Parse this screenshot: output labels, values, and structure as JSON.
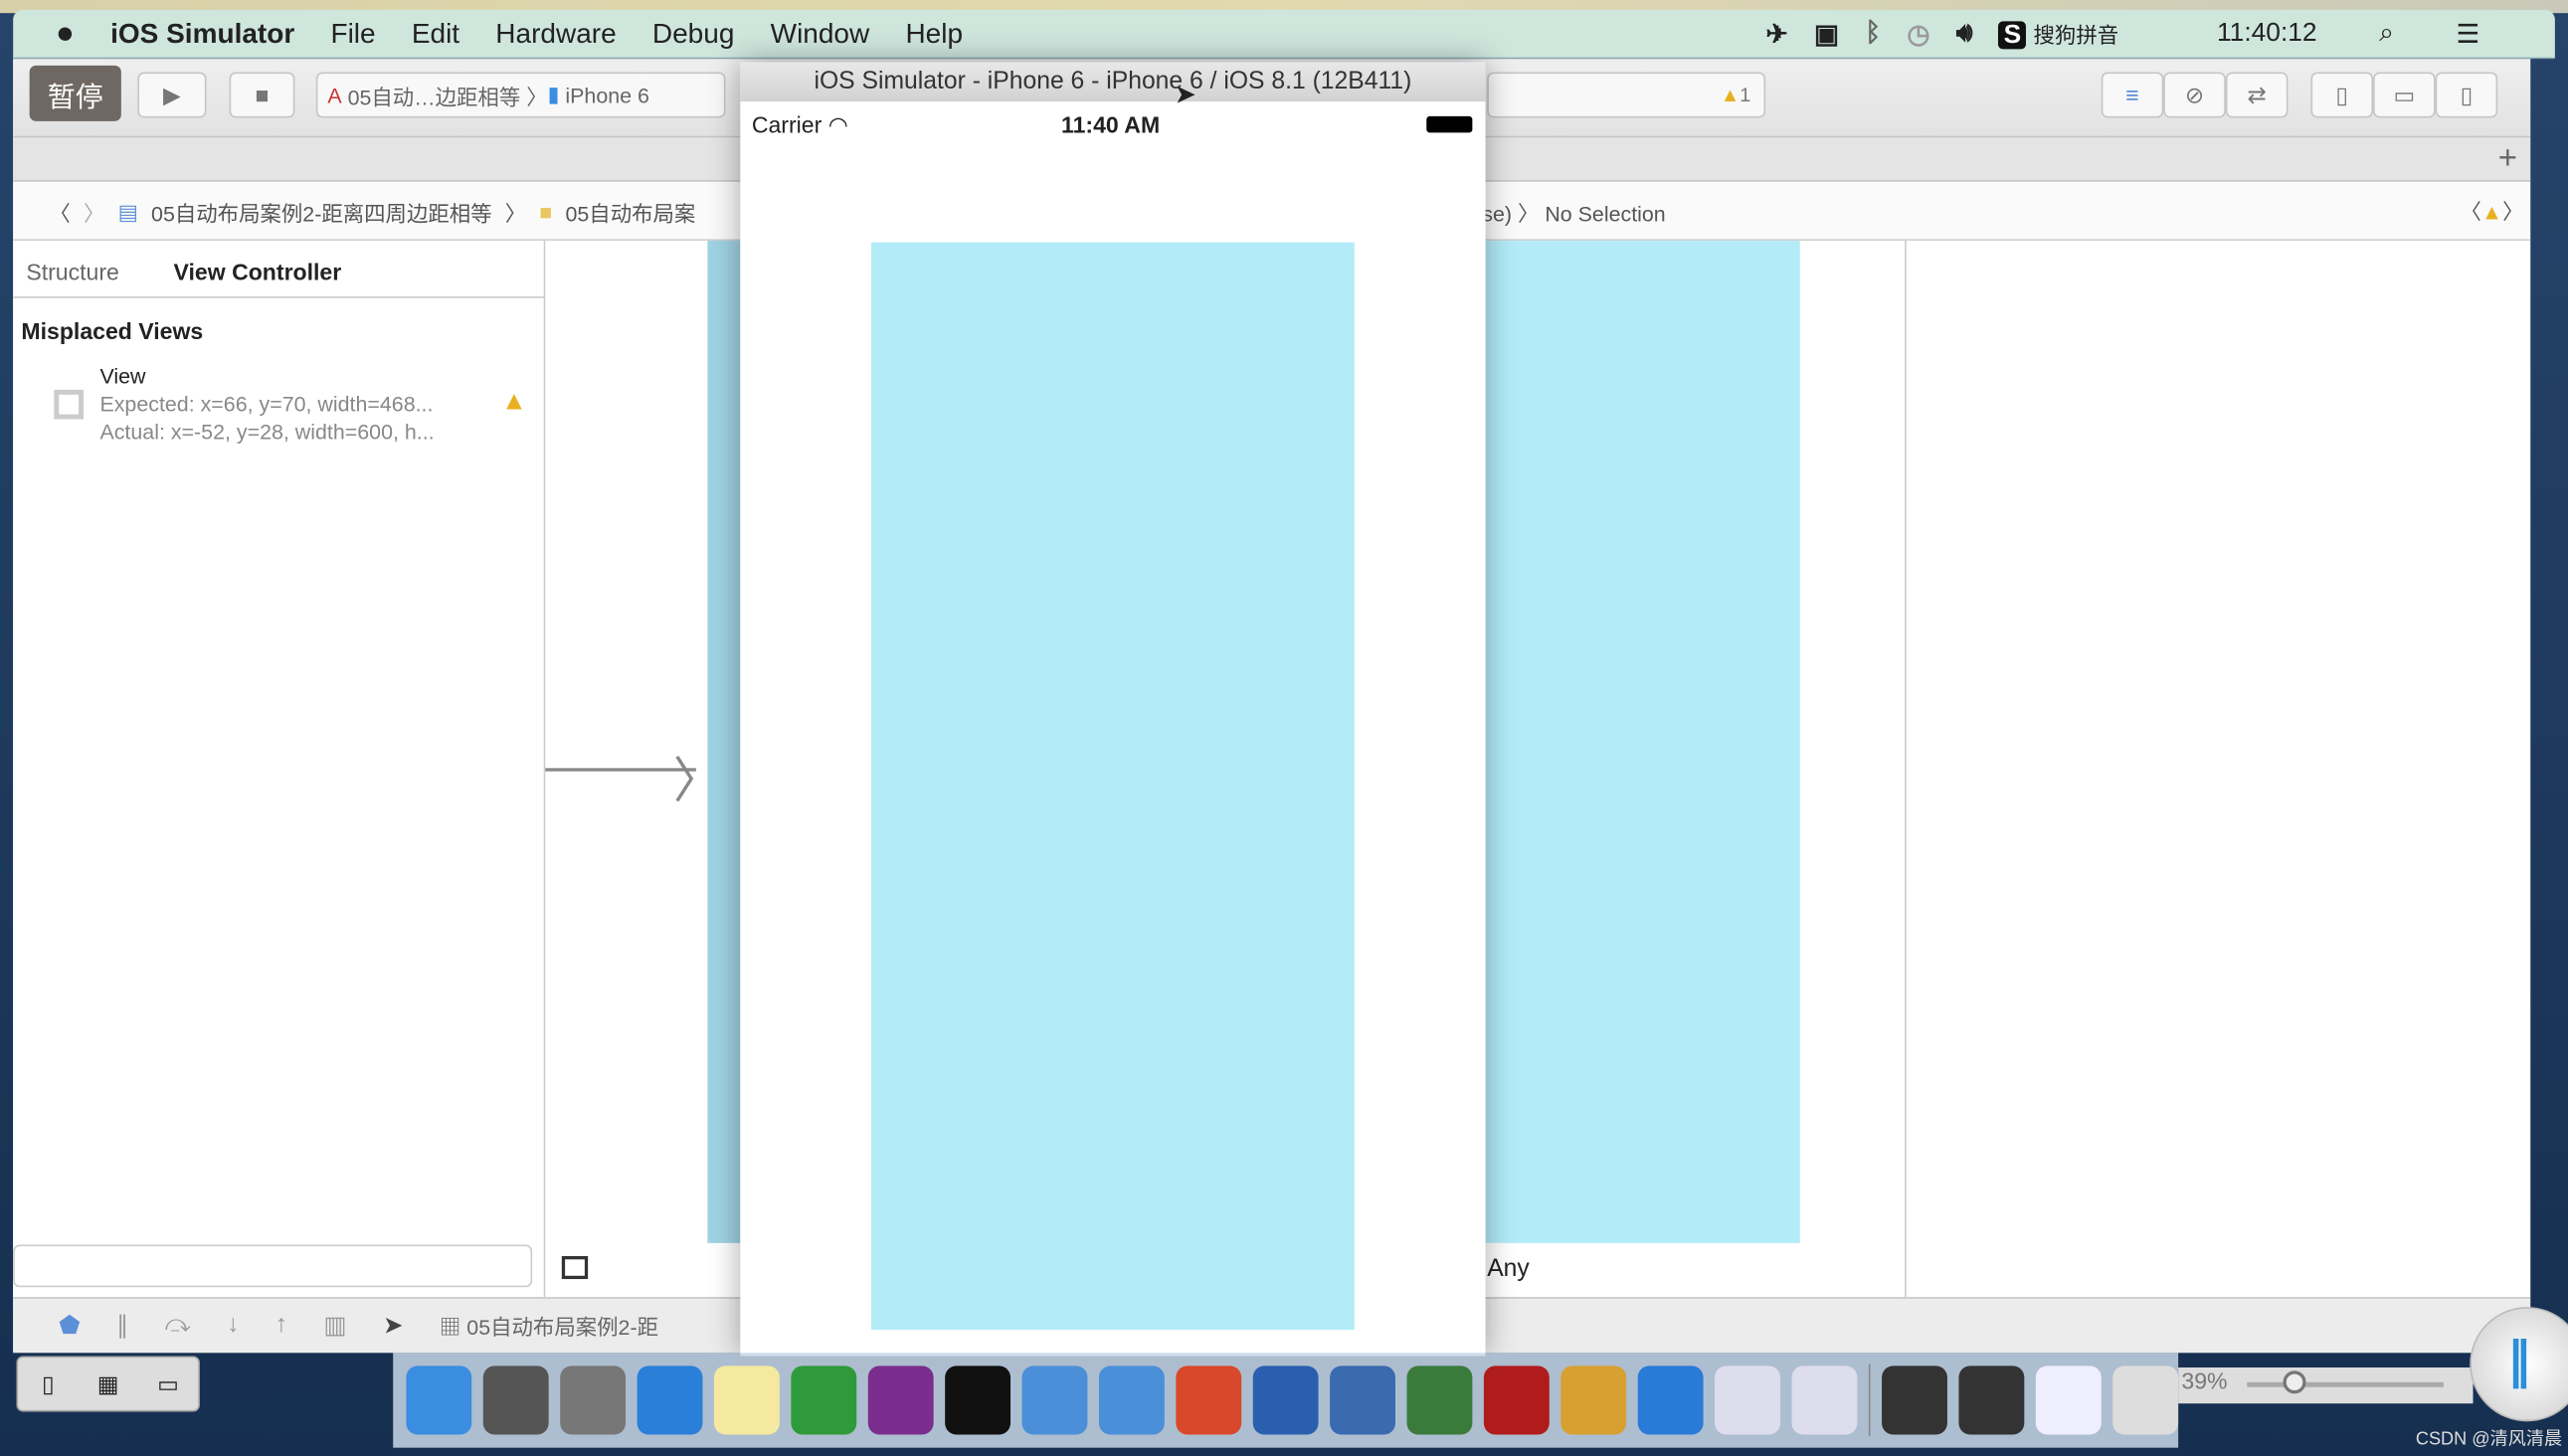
{
  "menubar": {
    "app": "iOS Simulator",
    "items": [
      "File",
      "Edit",
      "Hardware",
      "Debug",
      "Window",
      "Help"
    ],
    "input_method": "搜狗拼音",
    "clock": "11:40:12"
  },
  "toolbar": {
    "pause_label": "暂停",
    "scheme": "05自动…边距相等",
    "device": "iPhone 6",
    "warnings": "1"
  },
  "jumpbar": {
    "crumb1": "05自动布局案例2-距离四周边距相等",
    "crumb2": "05自动布局案",
    "crumb3": "se)",
    "crumb4": "No Selection"
  },
  "leftpanel": {
    "tabs": [
      "Structure",
      "View Controller"
    ],
    "section": "Misplaced Views",
    "item": {
      "name": "View",
      "expected": "Expected: x=66, y=70, width=468...",
      "actual": "Actual: x=-52, y=28, width=600, h..."
    }
  },
  "canvas": {
    "size_class": "Any"
  },
  "debugbar": {
    "target": "05自动布局案例2-距"
  },
  "simulator": {
    "title": "iOS Simulator - iPhone 6 - iPhone 6 / iOS 8.1 (12B411)",
    "carrier": "Carrier",
    "time": "11:40 AM",
    "view_color": "#b3ecf8"
  },
  "desktop": {
    "zoom_percent": "39%",
    "watermark": "CSDN @清风清晨"
  },
  "dock": [
    {
      "name": "finder",
      "color": "#3a8de0"
    },
    {
      "name": "system-preferences",
      "color": "#555"
    },
    {
      "name": "launchpad",
      "color": "#777"
    },
    {
      "name": "safari",
      "color": "#2a7fd8"
    },
    {
      "name": "notes",
      "color": "#f5e9a0"
    },
    {
      "name": "excel",
      "color": "#2f9a3a"
    },
    {
      "name": "onenote",
      "color": "#7a2d8c"
    },
    {
      "name": "terminal",
      "color": "#111"
    },
    {
      "name": "xcode",
      "color": "#4a8fd8"
    },
    {
      "name": "simulator",
      "color": "#4a8fd8"
    },
    {
      "name": "powerpoint",
      "color": "#d8482a"
    },
    {
      "name": "scissors",
      "color": "#2a5fb0"
    },
    {
      "name": "video",
      "color": "#3a6ab0"
    },
    {
      "name": "ftp",
      "color": "#3a7a3a"
    },
    {
      "name": "filezilla",
      "color": "#b01c1c"
    },
    {
      "name": "paint",
      "color": "#d8a030"
    },
    {
      "name": "word",
      "color": "#2a7ad8"
    },
    {
      "name": "app-a1",
      "color": "#dde"
    },
    {
      "name": "app-a2",
      "color": "#dde"
    },
    {
      "name": "screen1",
      "color": "#333"
    },
    {
      "name": "screen2",
      "color": "#333"
    },
    {
      "name": "screen3",
      "color": "#eef"
    },
    {
      "name": "trash",
      "color": "#ddd"
    }
  ]
}
